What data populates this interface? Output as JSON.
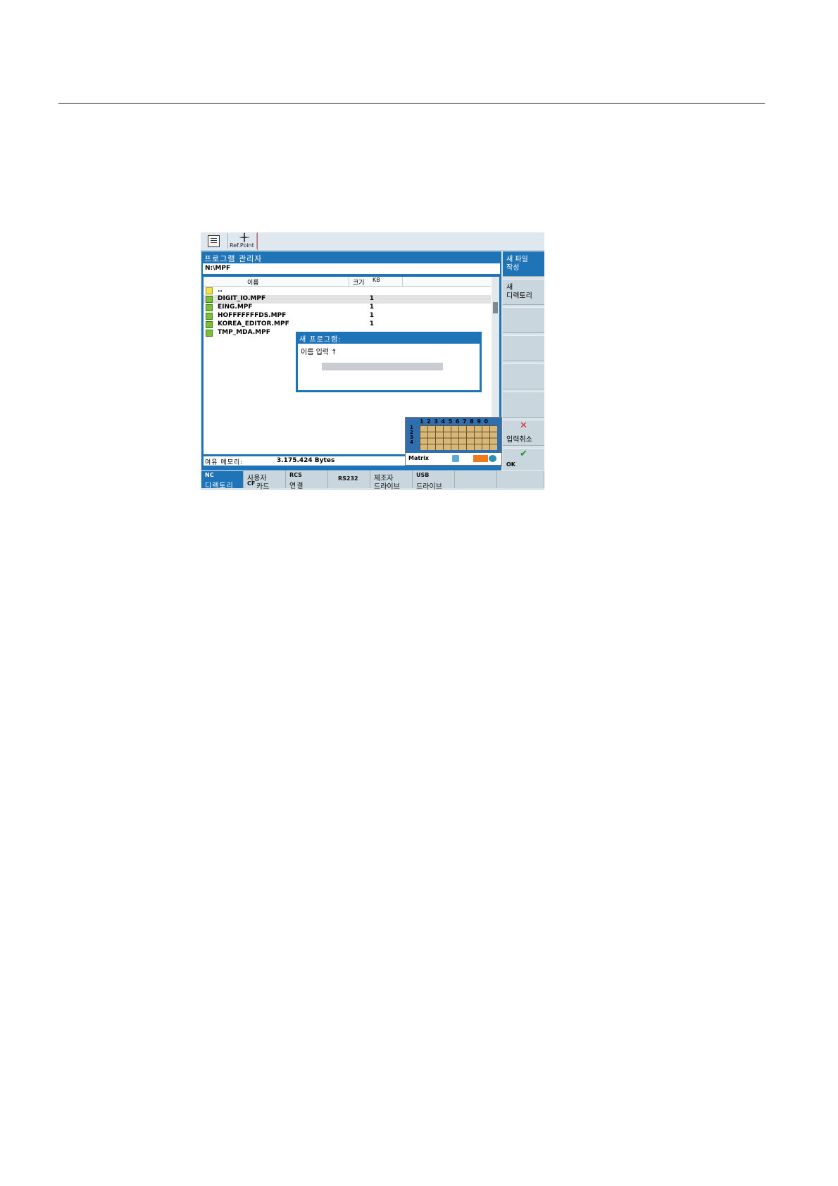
{
  "topbar": {
    "machine_icon": "machine-icon",
    "ref_point_glyph": "╶╋╴",
    "ref_point_label": "Ref.Point"
  },
  "window": {
    "title": "프로그램 관리자",
    "path": "N:\\MPF",
    "columns": {
      "name": "이름",
      "size": "크기",
      "unit": "KB"
    },
    "files": [
      {
        "name": "..",
        "size": "",
        "type": "up"
      },
      {
        "name": "DIGIT_IO.MPF",
        "size": "1",
        "type": "file"
      },
      {
        "name": "EING.MPF",
        "size": "1",
        "type": "file"
      },
      {
        "name": "HOFFFFFFFDS.MPF",
        "size": "1",
        "type": "file"
      },
      {
        "name": "KOREA_EDITOR.MPF",
        "size": "1",
        "type": "file"
      },
      {
        "name": "TMP_MDA.MPF",
        "size": "",
        "type": "file"
      }
    ],
    "memory_label": "여유 메모리:",
    "memory_value": "3.175.424 Bytes"
  },
  "dialog": {
    "title": "새 프로그램:",
    "label": "이름 입력 ↑",
    "input_value": ""
  },
  "keyboard": {
    "numbers": "1234567890",
    "row_numbers": [
      "1",
      "2",
      "3",
      "4"
    ],
    "name": "Matrix"
  },
  "right_softkeys": [
    {
      "line1": "새 파일",
      "line2": "작성",
      "active": true
    },
    {
      "line1": "새",
      "line2": "디렉토리",
      "active": false
    },
    {
      "line1": "",
      "line2": "",
      "active": false
    },
    {
      "line1": "",
      "line2": "",
      "active": false
    },
    {
      "line1": "",
      "line2": "",
      "active": false
    },
    {
      "line1": "",
      "line2": "",
      "active": false
    }
  ],
  "cancel_softkey": {
    "icon": "✕",
    "label": "입력취소",
    "color": "#e02020"
  },
  "ok_softkey": {
    "icon": "✔",
    "label": "OK",
    "color": "#1a9a2a"
  },
  "bottom_softkeys": [
    {
      "top": "NC",
      "bottom": "디렉토리",
      "active": true
    },
    {
      "top": "사용자",
      "prefix": "CF",
      "bottom": "카드",
      "active": false
    },
    {
      "top": "RCS",
      "bottom": "연결",
      "active": false
    },
    {
      "center": "RS232",
      "active": false
    },
    {
      "top": "제조자",
      "bottom": "드라이브",
      "active": false
    },
    {
      "top": "USB",
      "bottom": "드라이브",
      "active": false
    },
    {
      "top": "",
      "bottom": "",
      "active": false
    },
    {
      "top": "",
      "bottom": "",
      "active": false
    }
  ],
  "colors": {
    "window_blue": "#1f74b8",
    "softkey_grey": "#c9d6dd",
    "file_green": "#7cc03a"
  }
}
